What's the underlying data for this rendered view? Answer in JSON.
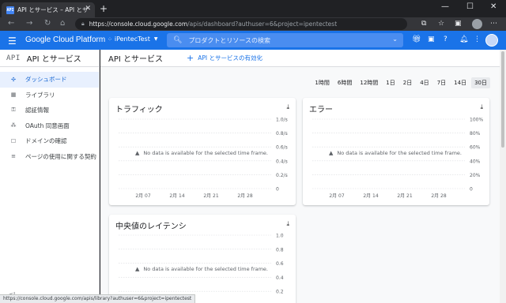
{
  "browser": {
    "tab_favicon": "API",
    "tab_title": "API とサービス – API とサービス – iPe",
    "url_host": "https://console.cloud.google.com",
    "url_path": "/apis/dashboard?authuser=6&project=ipentectest",
    "status_url": "https://console.cloud.google.com/apis/library?authuser=6&project=ipentectest"
  },
  "header": {
    "product_title": "Google Cloud Platform",
    "project_name": "iPentecTest",
    "search_placeholder": "プロダクトとリソースの検索"
  },
  "sidebar": {
    "api_mark": "API",
    "title": "API とサービス",
    "items": [
      {
        "label": "ダッシュボード",
        "icon": "dashboard-icon",
        "glyph": "✣"
      },
      {
        "label": "ライブラリ",
        "icon": "library-icon",
        "glyph": "▦"
      },
      {
        "label": "認証情報",
        "icon": "key-icon",
        "glyph": "⚿"
      },
      {
        "label": "OAuth 同意画面",
        "icon": "oauth-icon",
        "glyph": "⁂"
      },
      {
        "label": "ドメインの確認",
        "icon": "domain-verify-icon",
        "glyph": "☐"
      },
      {
        "label": "ページの使用に関する契約",
        "icon": "agreement-icon",
        "glyph": "≡"
      }
    ]
  },
  "main": {
    "title": "API とサービス",
    "enable_label": "API とサービスの有効化",
    "time_ranges": [
      "1時間",
      "6時間",
      "12時間",
      "1日",
      "2日",
      "4日",
      "7日",
      "14日",
      "30日"
    ],
    "active_range": "30日"
  },
  "cards": {
    "traffic": {
      "title": "トラフィック",
      "no_data": "No data is available for the selected time frame."
    },
    "errors": {
      "title": "エラー",
      "no_data": "No data is available for the selected time frame."
    },
    "latency": {
      "title": "中央値のレイテンシ",
      "no_data": "No data is available for the selected time frame."
    }
  },
  "chart_data": [
    {
      "type": "line",
      "title": "トラフィック",
      "yticks": [
        "1.0/s",
        "0.8/s",
        "0.6/s",
        "0.4/s",
        "0.2/s",
        "0"
      ],
      "xticks": [
        "2月 07",
        "2月 14",
        "2月 21",
        "2月 28"
      ],
      "ylim": [
        0,
        1.0
      ],
      "series": []
    },
    {
      "type": "line",
      "title": "エラー",
      "yticks": [
        "100%",
        "80%",
        "60%",
        "40%",
        "20%",
        "0"
      ],
      "xticks": [
        "2月 07",
        "2月 14",
        "2月 21",
        "2月 28"
      ],
      "ylim": [
        0,
        100
      ],
      "series": []
    },
    {
      "type": "line",
      "title": "中央値のレイテンシ",
      "yticks": [
        "1.0",
        "0.8",
        "0.6",
        "0.4",
        "0.2"
      ],
      "xticks": [],
      "ylim": [
        0,
        1.0
      ],
      "series": []
    }
  ],
  "colors": {
    "brand": "#1a73e8",
    "active_nav": "#e8f0fe"
  }
}
